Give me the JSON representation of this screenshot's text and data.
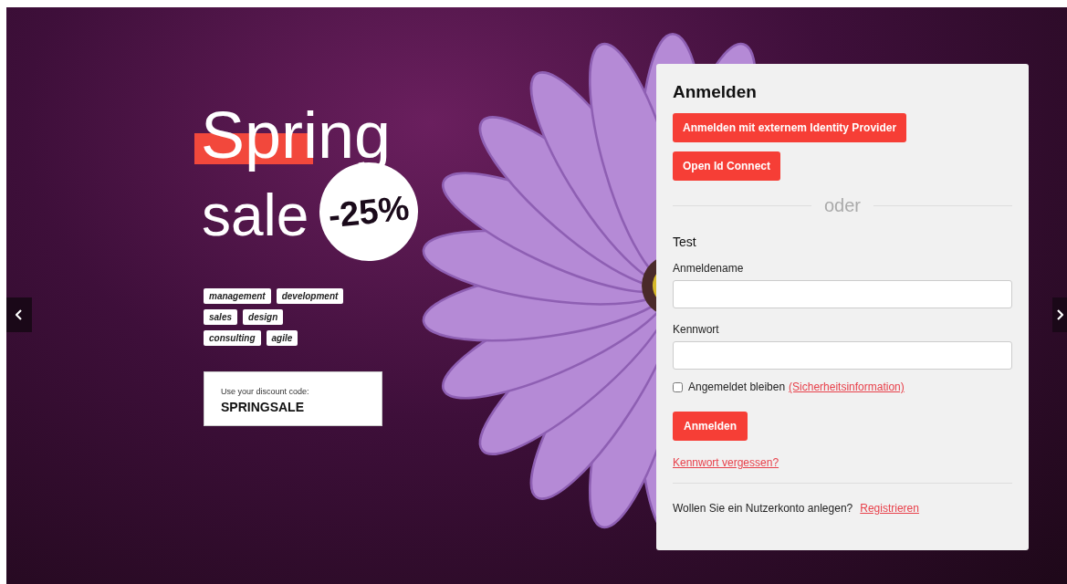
{
  "slide": {
    "headline_1": "Spring",
    "headline_2": "sale",
    "discount_badge": "-25%",
    "tags": [
      "management",
      "development",
      "sales",
      "design",
      "consulting",
      "agile"
    ],
    "code_label": "Use your discount code:",
    "code": "SPRINGSALE"
  },
  "login": {
    "title": "Anmelden",
    "external_buttons": [
      "Anmelden mit externem Identity Provider",
      "Open Id Connect"
    ],
    "divider": "oder",
    "section": "Test",
    "fields": [
      {
        "label": "Anmeldename"
      },
      {
        "label": "Kennwort"
      }
    ],
    "remember": {
      "label": "Angemeldet bleiben",
      "checked": false,
      "link": "(Sicherheitsinformation)"
    },
    "submit": "Anmelden",
    "forgot": "Kennwort vergessen?",
    "register_prompt": "Wollen Sie ein Nutzerkonto anlegen?",
    "register_link": "Registrieren"
  }
}
